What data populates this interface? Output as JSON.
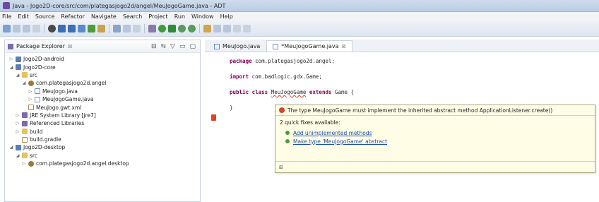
{
  "window": {
    "title": "Java - Jogo2D-core/src/com/plategasjogo2d/angel/MeuJogoGame.java - ADT"
  },
  "menu": [
    "File",
    "Edit",
    "Source",
    "Refactor",
    "Navigate",
    "Search",
    "Project",
    "Run",
    "Window",
    "Help"
  ],
  "explorer": {
    "tab_label": "Package Explorer",
    "tab_close": "☒",
    "tools": [
      "⊟",
      "⇆",
      "▽",
      "▭",
      "▢"
    ],
    "items": [
      {
        "label": "Jogo2D-android",
        "twisty": "▷",
        "icon": "project",
        "indent": 0
      },
      {
        "label": "Jogo2D-core",
        "twisty": "◢",
        "icon": "project",
        "indent": 0
      },
      {
        "label": "src",
        "twisty": "◢",
        "icon": "folder",
        "indent": 1
      },
      {
        "label": "com.plategasjogo2d.angel",
        "twisty": "◢",
        "icon": "package",
        "indent": 2
      },
      {
        "label": "MeuJogo.java",
        "twisty": "▷",
        "icon": "java",
        "indent": 3
      },
      {
        "label": "MeuJogoGame.java",
        "twisty": "▷",
        "icon": "java",
        "indent": 3
      },
      {
        "label": "MeuJogo.gwt.xml",
        "twisty": "",
        "icon": "xml",
        "indent": 2
      },
      {
        "label": "JRE System Library [jre7]",
        "twisty": "▷",
        "icon": "lib",
        "indent": 1
      },
      {
        "label": "Referenced Libraries",
        "twisty": "▷",
        "icon": "lib",
        "indent": 1
      },
      {
        "label": "build",
        "twisty": "▷",
        "icon": "folder",
        "indent": 1
      },
      {
        "label": "build.gradle",
        "twisty": "",
        "icon": "xml",
        "indent": 1
      },
      {
        "label": "Jogo2D-desktop",
        "twisty": "◢",
        "icon": "project",
        "indent": 0
      },
      {
        "label": "src",
        "twisty": "◢",
        "icon": "folder",
        "indent": 1
      },
      {
        "label": "com.plategasjogo2d.angel.desktop",
        "twisty": "▷",
        "icon": "package",
        "indent": 2
      }
    ]
  },
  "editor": {
    "tabs": [
      {
        "label": "MeuJogo.java",
        "active": false
      },
      {
        "label": "*MeuJogoGame.java",
        "active": true
      }
    ],
    "tab_close": "☒",
    "code": {
      "line1_kw": "package",
      "line1_rest": " com.plategasjogo2d.angel;",
      "line2_kw": "import",
      "line2_rest": " com.badlogic.gdx.Game;",
      "line3_kw1": "public class",
      "line3_err": "MeuJogoGame",
      "line3_kw2": " extends ",
      "line3_rest": "Game {",
      "line4": "}"
    }
  },
  "quickfix": {
    "message": "The type MeuJogoGame must implement the inherited abstract method ApplicationListener.create()",
    "count": "2 quick fixes available:",
    "fixes": [
      "Add unimplemented methods",
      "Make type 'MeuJogoGame' abstract"
    ],
    "footer_icon": "pin-icon"
  },
  "colors": {
    "keyword": "#7f0055",
    "error": "#d9442f",
    "link": "#1e4fa8",
    "hover_bg": "#fffde6"
  }
}
